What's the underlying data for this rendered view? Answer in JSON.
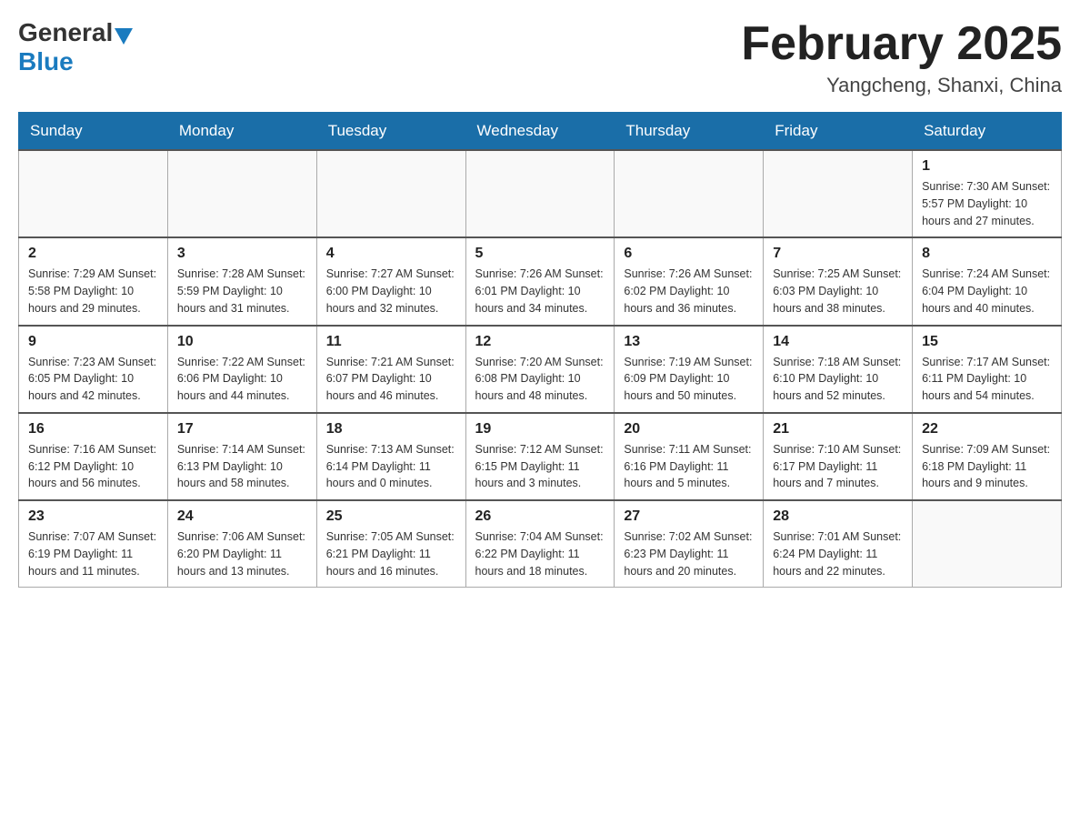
{
  "header": {
    "logo_general": "General",
    "logo_blue": "Blue",
    "month_title": "February 2025",
    "location": "Yangcheng, Shanxi, China"
  },
  "weekdays": [
    "Sunday",
    "Monday",
    "Tuesday",
    "Wednesday",
    "Thursday",
    "Friday",
    "Saturday"
  ],
  "weeks": [
    [
      {
        "day": "",
        "info": ""
      },
      {
        "day": "",
        "info": ""
      },
      {
        "day": "",
        "info": ""
      },
      {
        "day": "",
        "info": ""
      },
      {
        "day": "",
        "info": ""
      },
      {
        "day": "",
        "info": ""
      },
      {
        "day": "1",
        "info": "Sunrise: 7:30 AM\nSunset: 5:57 PM\nDaylight: 10 hours and 27 minutes."
      }
    ],
    [
      {
        "day": "2",
        "info": "Sunrise: 7:29 AM\nSunset: 5:58 PM\nDaylight: 10 hours and 29 minutes."
      },
      {
        "day": "3",
        "info": "Sunrise: 7:28 AM\nSunset: 5:59 PM\nDaylight: 10 hours and 31 minutes."
      },
      {
        "day": "4",
        "info": "Sunrise: 7:27 AM\nSunset: 6:00 PM\nDaylight: 10 hours and 32 minutes."
      },
      {
        "day": "5",
        "info": "Sunrise: 7:26 AM\nSunset: 6:01 PM\nDaylight: 10 hours and 34 minutes."
      },
      {
        "day": "6",
        "info": "Sunrise: 7:26 AM\nSunset: 6:02 PM\nDaylight: 10 hours and 36 minutes."
      },
      {
        "day": "7",
        "info": "Sunrise: 7:25 AM\nSunset: 6:03 PM\nDaylight: 10 hours and 38 minutes."
      },
      {
        "day": "8",
        "info": "Sunrise: 7:24 AM\nSunset: 6:04 PM\nDaylight: 10 hours and 40 minutes."
      }
    ],
    [
      {
        "day": "9",
        "info": "Sunrise: 7:23 AM\nSunset: 6:05 PM\nDaylight: 10 hours and 42 minutes."
      },
      {
        "day": "10",
        "info": "Sunrise: 7:22 AM\nSunset: 6:06 PM\nDaylight: 10 hours and 44 minutes."
      },
      {
        "day": "11",
        "info": "Sunrise: 7:21 AM\nSunset: 6:07 PM\nDaylight: 10 hours and 46 minutes."
      },
      {
        "day": "12",
        "info": "Sunrise: 7:20 AM\nSunset: 6:08 PM\nDaylight: 10 hours and 48 minutes."
      },
      {
        "day": "13",
        "info": "Sunrise: 7:19 AM\nSunset: 6:09 PM\nDaylight: 10 hours and 50 minutes."
      },
      {
        "day": "14",
        "info": "Sunrise: 7:18 AM\nSunset: 6:10 PM\nDaylight: 10 hours and 52 minutes."
      },
      {
        "day": "15",
        "info": "Sunrise: 7:17 AM\nSunset: 6:11 PM\nDaylight: 10 hours and 54 minutes."
      }
    ],
    [
      {
        "day": "16",
        "info": "Sunrise: 7:16 AM\nSunset: 6:12 PM\nDaylight: 10 hours and 56 minutes."
      },
      {
        "day": "17",
        "info": "Sunrise: 7:14 AM\nSunset: 6:13 PM\nDaylight: 10 hours and 58 minutes."
      },
      {
        "day": "18",
        "info": "Sunrise: 7:13 AM\nSunset: 6:14 PM\nDaylight: 11 hours and 0 minutes."
      },
      {
        "day": "19",
        "info": "Sunrise: 7:12 AM\nSunset: 6:15 PM\nDaylight: 11 hours and 3 minutes."
      },
      {
        "day": "20",
        "info": "Sunrise: 7:11 AM\nSunset: 6:16 PM\nDaylight: 11 hours and 5 minutes."
      },
      {
        "day": "21",
        "info": "Sunrise: 7:10 AM\nSunset: 6:17 PM\nDaylight: 11 hours and 7 minutes."
      },
      {
        "day": "22",
        "info": "Sunrise: 7:09 AM\nSunset: 6:18 PM\nDaylight: 11 hours and 9 minutes."
      }
    ],
    [
      {
        "day": "23",
        "info": "Sunrise: 7:07 AM\nSunset: 6:19 PM\nDaylight: 11 hours and 11 minutes."
      },
      {
        "day": "24",
        "info": "Sunrise: 7:06 AM\nSunset: 6:20 PM\nDaylight: 11 hours and 13 minutes."
      },
      {
        "day": "25",
        "info": "Sunrise: 7:05 AM\nSunset: 6:21 PM\nDaylight: 11 hours and 16 minutes."
      },
      {
        "day": "26",
        "info": "Sunrise: 7:04 AM\nSunset: 6:22 PM\nDaylight: 11 hours and 18 minutes."
      },
      {
        "day": "27",
        "info": "Sunrise: 7:02 AM\nSunset: 6:23 PM\nDaylight: 11 hours and 20 minutes."
      },
      {
        "day": "28",
        "info": "Sunrise: 7:01 AM\nSunset: 6:24 PM\nDaylight: 11 hours and 22 minutes."
      },
      {
        "day": "",
        "info": ""
      }
    ]
  ]
}
